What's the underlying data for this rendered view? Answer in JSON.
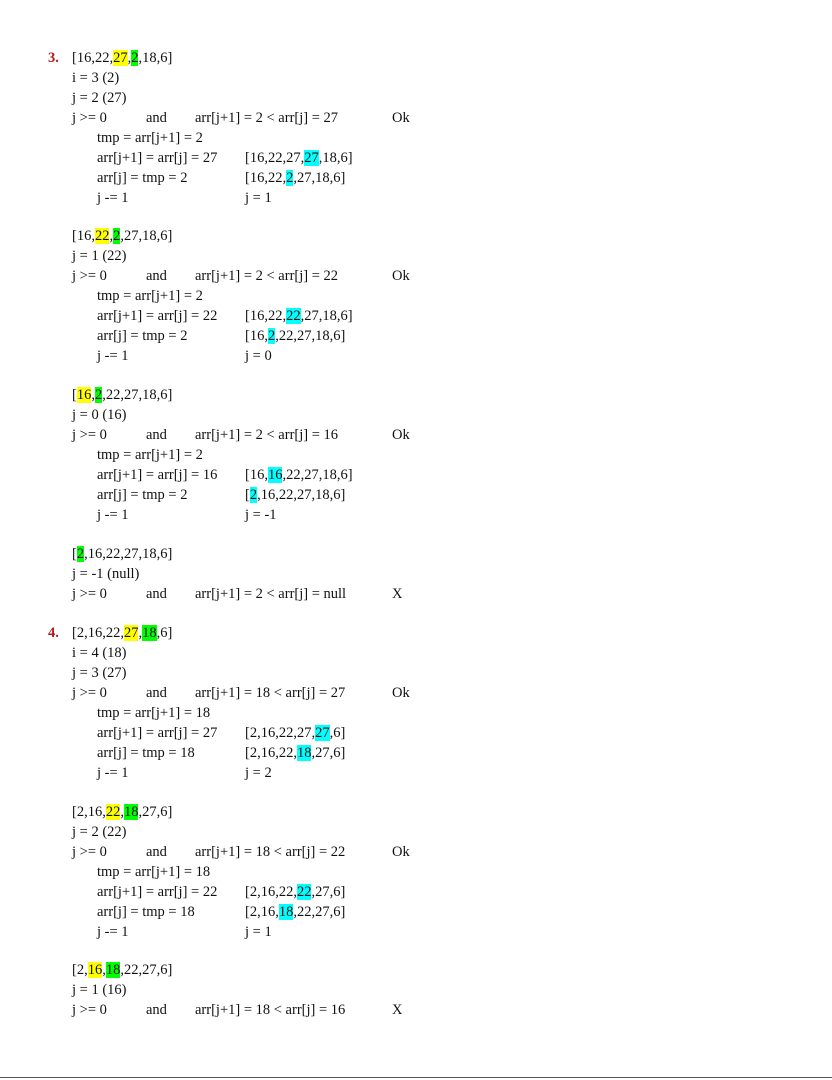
{
  "sections": [
    {
      "num": "3.",
      "blocks": [
        {
          "array": [
            {
              "t": "[16,22,"
            },
            {
              "t": "27",
              "h": "y"
            },
            {
              "t": ","
            },
            {
              "t": "2",
              "h": "g"
            },
            {
              "t": ",18,6]"
            }
          ],
          "info": [
            "i = 3 (2)",
            "j = 2 (27)"
          ],
          "cond": {
            "j": "j >= 0",
            "and": "and",
            "cmp": "arr[j+1] = 2 < arr[j] = 27",
            "res": "Ok"
          },
          "steps": [
            {
              "a": "tmp = arr[j+1] = 2"
            },
            {
              "a": "arr[j+1] = arr[j] = 27",
              "b": [
                {
                  "t": "[16,22,27,"
                },
                {
                  "t": "27",
                  "h": "c"
                },
                {
                  "t": ",18,6]"
                }
              ]
            },
            {
              "a": "arr[j] = tmp = 2",
              "b": [
                {
                  "t": "[16,22,"
                },
                {
                  "t": "2",
                  "h": "c"
                },
                {
                  "t": ",27,18,6]"
                }
              ]
            },
            {
              "a": "j -= 1",
              "b": [
                {
                  "t": "j = 1"
                }
              ]
            }
          ]
        },
        {
          "array": [
            {
              "t": "[16,"
            },
            {
              "t": "22",
              "h": "y"
            },
            {
              "t": ","
            },
            {
              "t": "2",
              "h": "g"
            },
            {
              "t": ",27,18,6]"
            }
          ],
          "info": [
            "j = 1 (22)"
          ],
          "cond": {
            "j": "j >= 0",
            "and": "and",
            "cmp": "arr[j+1] = 2 < arr[j] = 22",
            "res": "Ok"
          },
          "steps": [
            {
              "a": "tmp = arr[j+1] = 2"
            },
            {
              "a": "arr[j+1] = arr[j] = 22",
              "b": [
                {
                  "t": "[16,22,"
                },
                {
                  "t": "22",
                  "h": "c"
                },
                {
                  "t": ",27,18,6]"
                }
              ]
            },
            {
              "a": "arr[j] = tmp = 2",
              "b": [
                {
                  "t": "[16,"
                },
                {
                  "t": "2",
                  "h": "c"
                },
                {
                  "t": ",22,27,18,6]"
                }
              ]
            },
            {
              "a": "j -= 1",
              "b": [
                {
                  "t": "j = 0"
                }
              ]
            }
          ]
        },
        {
          "array": [
            {
              "t": "["
            },
            {
              "t": "16",
              "h": "y"
            },
            {
              "t": ","
            },
            {
              "t": "2",
              "h": "g"
            },
            {
              "t": ",22,27,18,6]"
            }
          ],
          "info": [
            "j = 0 (16)"
          ],
          "cond": {
            "j": "j >= 0",
            "and": "and",
            "cmp": "arr[j+1] = 2 < arr[j] = 16",
            "res": "Ok"
          },
          "steps": [
            {
              "a": "tmp = arr[j+1] = 2"
            },
            {
              "a": "arr[j+1] = arr[j] = 16",
              "b": [
                {
                  "t": "[16,"
                },
                {
                  "t": "16",
                  "h": "c"
                },
                {
                  "t": ",22,27,18,6]"
                }
              ]
            },
            {
              "a": "arr[j] = tmp = 2",
              "b": [
                {
                  "t": "["
                },
                {
                  "t": "2",
                  "h": "c"
                },
                {
                  "t": ",16,22,27,18,6]"
                }
              ]
            },
            {
              "a": "j -= 1",
              "b": [
                {
                  "t": "j = -1"
                }
              ]
            }
          ]
        },
        {
          "array": [
            {
              "t": "["
            },
            {
              "t": "2",
              "h": "g"
            },
            {
              "t": ",16,22,27,18,6]"
            }
          ],
          "info": [
            "j = -1 (null)"
          ],
          "cond": {
            "j": "j >= 0",
            "and": "and",
            "cmp": "arr[j+1] = 2 < arr[j] = null",
            "res": "X"
          },
          "steps": []
        }
      ]
    },
    {
      "num": "4.",
      "blocks": [
        {
          "array": [
            {
              "t": "[2,16,22,"
            },
            {
              "t": "27",
              "h": "y"
            },
            {
              "t": ","
            },
            {
              "t": "18",
              "h": "g"
            },
            {
              "t": ",6]"
            }
          ],
          "info": [
            "i = 4 (18)",
            "j = 3 (27)"
          ],
          "cond": {
            "j": "j >= 0",
            "and": "and",
            "cmp": "arr[j+1] = 18 < arr[j] = 27",
            "res": "Ok"
          },
          "steps": [
            {
              "a": "tmp = arr[j+1] = 18"
            },
            {
              "a": "arr[j+1] = arr[j] = 27",
              "b": [
                {
                  "t": "[2,16,22,27,"
                },
                {
                  "t": "27",
                  "h": "c"
                },
                {
                  "t": ",6]"
                }
              ]
            },
            {
              "a": "arr[j] = tmp = 18",
              "b": [
                {
                  "t": "[2,16,22,"
                },
                {
                  "t": "18",
                  "h": "c"
                },
                {
                  "t": ",27,6]"
                }
              ]
            },
            {
              "a": "j -= 1",
              "b": [
                {
                  "t": "j = 2"
                }
              ]
            }
          ]
        },
        {
          "array": [
            {
              "t": "[2,16,"
            },
            {
              "t": "22",
              "h": "y"
            },
            {
              "t": ","
            },
            {
              "t": "18",
              "h": "g"
            },
            {
              "t": ",27,6]"
            }
          ],
          "info": [
            "j = 2 (22)"
          ],
          "cond": {
            "j": "j >= 0",
            "and": "and",
            "cmp": "arr[j+1] = 18 < arr[j] = 22",
            "res": "Ok"
          },
          "steps": [
            {
              "a": "tmp = arr[j+1] = 18"
            },
            {
              "a": "arr[j+1] = arr[j] = 22",
              "b": [
                {
                  "t": "[2,16,22,"
                },
                {
                  "t": "22",
                  "h": "c"
                },
                {
                  "t": ",27,6]"
                }
              ]
            },
            {
              "a": "arr[j] = tmp = 18",
              "b": [
                {
                  "t": "[2,16,"
                },
                {
                  "t": "18",
                  "h": "c"
                },
                {
                  "t": ",22,27,6]"
                }
              ]
            },
            {
              "a": "j -= 1",
              "b": [
                {
                  "t": "j = 1"
                }
              ]
            }
          ]
        },
        {
          "array": [
            {
              "t": "[2,"
            },
            {
              "t": "16",
              "h": "y"
            },
            {
              "t": ","
            },
            {
              "t": "18",
              "h": "g"
            },
            {
              "t": ",22,27,6]"
            }
          ],
          "info": [
            "j = 1 (16)"
          ],
          "cond": {
            "j": "j >= 0",
            "and": "and",
            "cmp": "arr[j+1] = 18 < arr[j] = 16",
            "res": "X"
          },
          "steps": []
        }
      ]
    }
  ],
  "colors": {
    "number": "#b01c1c",
    "current_key": "#00ff00",
    "compared": "#ffff00",
    "changed": "#00ffff"
  }
}
